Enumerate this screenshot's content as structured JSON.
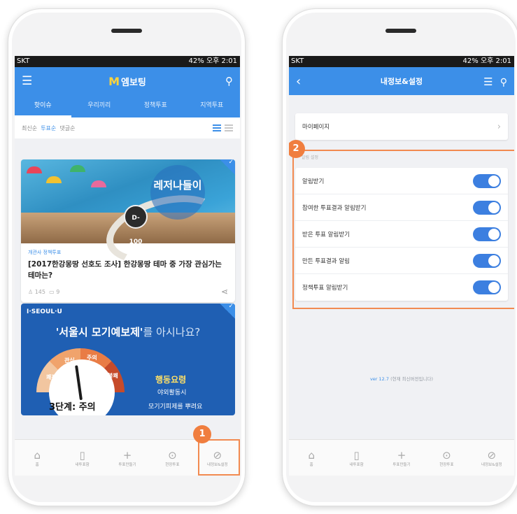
{
  "status_bar": {
    "carrier": "SKT",
    "right_text": "42% 오후 2:01"
  },
  "left_screen": {
    "app_title_m": "M",
    "app_title": "엠보팅",
    "tabs": [
      {
        "label": "핫이슈",
        "active": true
      },
      {
        "label": "우리끼리",
        "active": false
      },
      {
        "label": "정책투표",
        "active": false
      },
      {
        "label": "지역투표",
        "active": false
      }
    ],
    "sort": {
      "options": [
        "최신순",
        "투표순",
        "댓글순"
      ],
      "selected": "투표순"
    },
    "card1": {
      "image_text_summer": "레저나들이",
      "image_text_dday": "D-100",
      "category": "개관사 정책투표",
      "title": "[2017한강몽땅 선호도 조사] 한강몽땅 테마 중 가장 관심가는 테마는?",
      "participants": "145",
      "comments": "9"
    },
    "card2": {
      "brand": "I·SEOUL·U",
      "title_main": "'서울시 모기예보제'",
      "title_sub": "를 아시나요?",
      "gauge_labels": [
        "쾌적",
        "관심",
        "주의",
        "불쾌"
      ],
      "stage": "3단계: 주의",
      "action_title": "행동요령",
      "action_line1": "야외활동시",
      "action_line2": "모기기피제를 뿌려요"
    },
    "callout_number": "1"
  },
  "right_screen": {
    "title": "내정보&설정",
    "mypage": "마이페이지",
    "section_label": "알림 설정",
    "settings": [
      {
        "label": "알림받기",
        "on": true
      },
      {
        "label": "참여한 투표결과 알림받기",
        "on": true
      },
      {
        "label": "받은 투표 알림받기",
        "on": true
      },
      {
        "label": "만든 투표결과 알림",
        "on": true
      },
      {
        "label": "정책투표 알림받기",
        "on": true
      }
    ],
    "version_prefix": "ver 12.7",
    "version_suffix": "(현재 최신버전입니다)",
    "callout_number": "2"
  },
  "bottom_nav": [
    {
      "label": "홈",
      "icon": "home-icon",
      "glyph": "⌂"
    },
    {
      "label": "내투표함",
      "icon": "document-icon",
      "glyph": "▯"
    },
    {
      "label": "투표만들기",
      "icon": "plus-icon",
      "glyph": "+"
    },
    {
      "label": "현장투표",
      "icon": "location-pin-icon",
      "glyph": "⊙"
    },
    {
      "label": "내정보&설정",
      "icon": "settings-icon",
      "glyph": "⊘"
    }
  ],
  "colors": {
    "accent": "#3c8fe8",
    "callout": "#f07e3f",
    "toggle_on": "#3c7fe0"
  }
}
